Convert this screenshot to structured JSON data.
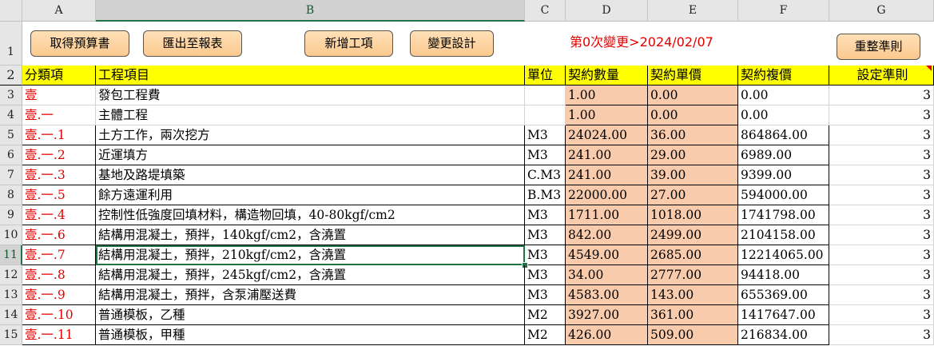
{
  "columns": [
    "A",
    "B",
    "C",
    "D",
    "E",
    "F",
    "G"
  ],
  "selection": {
    "active_cell": "B11"
  },
  "toolbar": {
    "get_budget": "取得預算書",
    "export_report": "匯出至報表",
    "add_item": "新增工項",
    "change_design": "變更設計",
    "reset_rules": "重整準則"
  },
  "change_info": "第0次變更>2024/02/07",
  "header_row": {
    "row": "2",
    "category": "分類項",
    "item": "工程項目",
    "unit": "單位",
    "quantity": "契約數量",
    "unit_price": "契約單價",
    "total_price": "契約複價",
    "rule": "設定準則"
  },
  "rows": [
    {
      "row": "3",
      "category": "壹",
      "item": "發包工程費",
      "unit": "",
      "quantity": "1.00",
      "unit_price": "0.00",
      "total_price": "0.00",
      "rule": "3"
    },
    {
      "row": "4",
      "category": "壹.一",
      "item": "主體工程",
      "unit": "",
      "quantity": "1.00",
      "unit_price": "0.00",
      "total_price": "0.00",
      "rule": "3"
    },
    {
      "row": "5",
      "category": "壹.一.1",
      "item": "土方工作，兩次挖方",
      "unit": "M3",
      "quantity": "24024.00",
      "unit_price": "36.00",
      "total_price": "864864.00",
      "rule": "3"
    },
    {
      "row": "6",
      "category": "壹.一.2",
      "item": "近運填方",
      "unit": "M3",
      "quantity": "241.00",
      "unit_price": "29.00",
      "total_price": "6989.00",
      "rule": "3"
    },
    {
      "row": "7",
      "category": "壹.一.3",
      "item": "基地及路堤填築",
      "unit": "C.M3",
      "quantity": "241.00",
      "unit_price": "39.00",
      "total_price": "9399.00",
      "rule": "3"
    },
    {
      "row": "8",
      "category": "壹.一.5",
      "item": "餘方遠運利用",
      "unit": "B.M3",
      "quantity": "22000.00",
      "unit_price": "27.00",
      "total_price": "594000.00",
      "rule": "3"
    },
    {
      "row": "9",
      "category": "壹.一.4",
      "item": "控制性低強度回填材料，構造物回填，40-80kgf/cm2",
      "unit": "M3",
      "quantity": "1711.00",
      "unit_price": "1018.00",
      "total_price": "1741798.00",
      "rule": "3"
    },
    {
      "row": "10",
      "category": "壹.一.6",
      "item": "結構用混凝土，預拌，140kgf/cm2，含澆置",
      "unit": "M3",
      "quantity": "842.00",
      "unit_price": "2499.00",
      "total_price": "2104158.00",
      "rule": "3"
    },
    {
      "row": "11",
      "category": "壹.一.7",
      "item": "結構用混凝土，預拌，210kgf/cm2，含澆置",
      "unit": "M3",
      "quantity": "4549.00",
      "unit_price": "2685.00",
      "total_price": "12214065.00",
      "rule": "3"
    },
    {
      "row": "12",
      "category": "壹.一.8",
      "item": "結構用混凝土，預拌，245kgf/cm2，含澆置",
      "unit": "M3",
      "quantity": "34.00",
      "unit_price": "2777.00",
      "total_price": "94418.00",
      "rule": "3"
    },
    {
      "row": "13",
      "category": "壹.一.9",
      "item": "結構用混凝土，預拌，含泵浦壓送費",
      "unit": "M3",
      "quantity": "4583.00",
      "unit_price": "143.00",
      "total_price": "655369.00",
      "rule": "3"
    },
    {
      "row": "14",
      "category": "壹.一.10",
      "item": "普通模板，乙種",
      "unit": "M2",
      "quantity": "3927.00",
      "unit_price": "361.00",
      "total_price": "1417647.00",
      "rule": "3"
    },
    {
      "row": "15",
      "category": "壹.一.11",
      "item": "普通模板，甲種",
      "unit": "M2",
      "quantity": "426.00",
      "unit_price": "509.00",
      "total_price": "216834.00",
      "rule": "3"
    }
  ],
  "row_one_label": "1",
  "colors": {
    "accent_red": "#e00000",
    "header_yellow": "#ffff00",
    "peach": "#f8cbad",
    "button": "#fbc98e",
    "selection_green": "#217346"
  }
}
